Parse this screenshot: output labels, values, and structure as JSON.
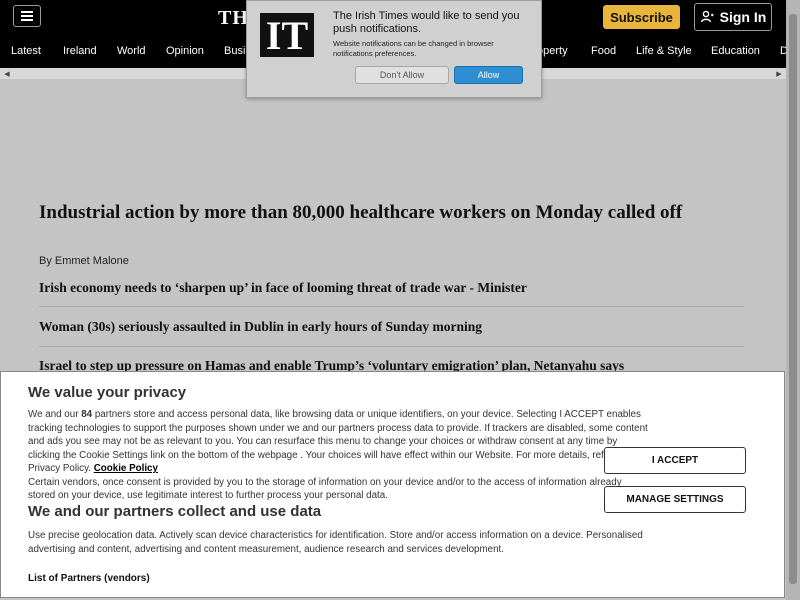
{
  "header": {
    "logo_text": "THE",
    "subscribe_label": "Subscribe",
    "signin_label": "Sign In"
  },
  "nav": {
    "items": [
      "Latest",
      "Ireland",
      "World",
      "Opinion",
      "Busi",
      "operty",
      "Food",
      "Life & Style",
      "Education",
      "D"
    ]
  },
  "notification": {
    "logo": "IT",
    "title": "The Irish Times would like to send you push notifications.",
    "subtitle": "Website notifications can be changed in browser notifications preferences.",
    "dont_allow_label": "Don't Allow",
    "allow_label": "Allow"
  },
  "articles": {
    "main_headline": "Industrial action by more than 80,000 healthcare workers on Monday called off",
    "byline": "By Emmet Malone",
    "links": [
      "Irish economy needs to ‘sharpen up’ in face of looming threat of trade war - Minister",
      "Woman (30s) seriously assaulted in Dublin in early hours of Sunday morning",
      "Israel to step up pressure on Hamas and enable Trump’s ‘voluntary emigration’ plan, Netanyahu says"
    ]
  },
  "consent": {
    "title": "We value your privacy",
    "body_prefix": "We and our ",
    "partner_count": "84",
    "body_main": " partners store and access personal data, like browsing data or unique identifiers, on your device. Selecting I ACCEPT enables tracking technologies to support the purposes shown under we and our partners process data to provide. If trackers are disabled, some content and ads you see may not be as relevant to you. You can resurface this menu to change your choices or withdraw consent at any time by clicking the Cookie Settings link on the bottom of the webpage . Your choices will have effect within our Website. For more details, refer to our Privacy Policy. ",
    "policy_link": "Cookie Policy",
    "body_after": "Certain vendors, once consent is provided by you to the storage of information on your device and/or to the access of information already stored on your device, use legitimate interest to further process your personal data.",
    "title2": "We and our partners collect and use data",
    "body2": "Use precise geolocation data. Actively scan device characteristics for identification. Store and/or access information on a device. Personalised advertising and content, advertising and content measurement, audience research and services development.",
    "partners_link": "List of Partners (vendors)",
    "accept_label": "I ACCEPT",
    "manage_label": "MANAGE SETTINGS"
  }
}
